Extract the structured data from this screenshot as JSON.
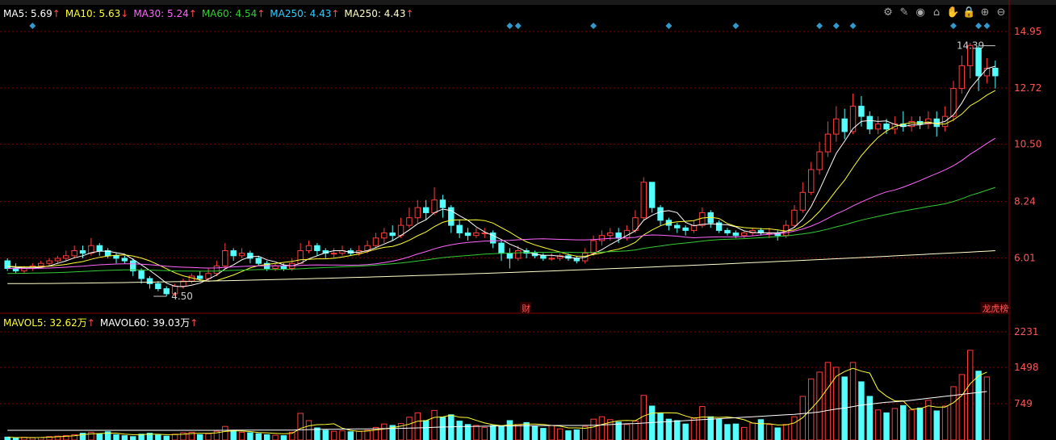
{
  "ma_legend": [
    {
      "label": "MA5: 5.69",
      "arrow": "↑",
      "color": "#ffffff"
    },
    {
      "label": "MA10: 5.63",
      "arrow": "↓",
      "color": "#ffff33"
    },
    {
      "label": "MA30: 5.24",
      "arrow": "↑",
      "color": "#ff66ff"
    },
    {
      "label": "MA60: 4.54",
      "arrow": "↑",
      "color": "#33cc33"
    },
    {
      "label": "MA250: 4.43",
      "arrow": "↑",
      "color": "#33ccff"
    },
    {
      "label": "MA250: 4.43",
      "arrow": "↑",
      "color": "#ffffcc"
    }
  ],
  "vol_legend": [
    {
      "label": "MAVOL5: 32.62万",
      "arrow": "↑",
      "color": "#ffff33"
    },
    {
      "label": "MAVOL60: 39.03万",
      "arrow": "↑",
      "color": "#ffffff"
    }
  ],
  "toolbar_icons": [
    "gear-icon",
    "pen-icon",
    "eye-icon",
    "basket-icon",
    "hand-icon",
    "lock-icon",
    "zoom-in-icon",
    "zoom-out-icon"
  ],
  "colors": {
    "up": "#ff3c3c",
    "down": "#54ffff",
    "grid": "#8b0000"
  },
  "chart_data": [
    {
      "type": "candlestick",
      "y_ticks": [
        "14.95",
        "12.72",
        "10.50",
        "8.24",
        "6.01"
      ],
      "ylim": [
        4.15,
        15.3
      ],
      "annotations": [
        {
          "text": "14.39",
          "index": 118,
          "value": 14.39
        },
        {
          "text": "4.50",
          "index": 19,
          "value": 4.5
        },
        {
          "text": "财",
          "index": 62
        },
        {
          "text": "龙虎榜",
          "index": 117
        }
      ],
      "markers_index": [
        3,
        60,
        61,
        70,
        79,
        87,
        97,
        99,
        101,
        113,
        116,
        117
      ],
      "candles": [
        [
          5.9,
          5.6,
          6.0,
          5.5
        ],
        [
          5.6,
          5.5,
          5.8,
          5.4
        ],
        [
          5.5,
          5.6,
          5.7,
          5.4
        ],
        [
          5.6,
          5.7,
          5.8,
          5.5
        ],
        [
          5.7,
          5.8,
          5.9,
          5.6
        ],
        [
          5.8,
          5.9,
          6.0,
          5.7
        ],
        [
          5.9,
          6.0,
          6.1,
          5.8
        ],
        [
          6.0,
          6.1,
          6.3,
          5.9
        ],
        [
          6.1,
          6.3,
          6.5,
          6.0
        ],
        [
          6.3,
          6.2,
          6.5,
          6.0
        ],
        [
          6.2,
          6.5,
          6.8,
          6.1
        ],
        [
          6.5,
          6.3,
          6.6,
          6.1
        ],
        [
          6.3,
          6.1,
          6.4,
          6.0
        ],
        [
          6.1,
          6.0,
          6.2,
          5.8
        ],
        [
          6.0,
          5.9,
          6.1,
          5.8
        ],
        [
          5.9,
          5.5,
          6.0,
          5.3
        ],
        [
          5.5,
          5.2,
          5.6,
          5.0
        ],
        [
          5.2,
          5.0,
          5.3,
          4.8
        ],
        [
          5.0,
          4.8,
          5.1,
          4.7
        ],
        [
          4.8,
          4.6,
          4.9,
          4.5
        ],
        [
          4.6,
          4.9,
          5.0,
          4.5
        ],
        [
          4.9,
          5.1,
          5.2,
          4.8
        ],
        [
          5.1,
          5.3,
          5.4,
          5.0
        ],
        [
          5.3,
          5.2,
          5.5,
          5.1
        ],
        [
          5.2,
          5.4,
          5.6,
          5.1
        ],
        [
          5.4,
          5.7,
          5.9,
          5.3
        ],
        [
          5.7,
          6.3,
          6.6,
          5.6
        ],
        [
          6.3,
          6.1,
          6.4,
          5.9
        ],
        [
          6.1,
          6.2,
          6.4,
          6.0
        ],
        [
          6.2,
          6.0,
          6.3,
          5.8
        ],
        [
          6.0,
          5.8,
          6.1,
          5.7
        ],
        [
          5.8,
          5.6,
          5.9,
          5.5
        ],
        [
          5.6,
          5.7,
          5.8,
          5.5
        ],
        [
          5.7,
          5.6,
          5.8,
          5.5
        ],
        [
          5.6,
          5.8,
          6.0,
          5.5
        ],
        [
          5.8,
          6.3,
          6.6,
          5.8
        ],
        [
          6.3,
          6.5,
          6.7,
          6.2
        ],
        [
          6.5,
          6.3,
          6.6,
          6.1
        ],
        [
          6.3,
          6.2,
          6.4,
          6.0
        ],
        [
          6.2,
          6.2,
          6.4,
          6.0
        ],
        [
          6.2,
          6.3,
          6.5,
          6.1
        ],
        [
          6.3,
          6.2,
          6.4,
          6.1
        ],
        [
          6.2,
          6.3,
          6.5,
          6.1
        ],
        [
          6.3,
          6.5,
          6.7,
          6.2
        ],
        [
          6.5,
          6.8,
          7.0,
          6.4
        ],
        [
          6.8,
          7.0,
          7.2,
          6.6
        ],
        [
          7.0,
          6.9,
          7.3,
          6.7
        ],
        [
          6.9,
          7.3,
          7.6,
          6.8
        ],
        [
          7.3,
          7.6,
          8.0,
          7.2
        ],
        [
          7.6,
          8.0,
          8.3,
          7.4
        ],
        [
          8.0,
          7.8,
          8.3,
          7.5
        ],
        [
          7.8,
          8.3,
          8.8,
          7.7
        ],
        [
          8.3,
          8.0,
          8.5,
          7.6
        ],
        [
          8.0,
          7.3,
          8.1,
          7.0
        ],
        [
          7.3,
          7.0,
          7.5,
          6.8
        ],
        [
          7.0,
          6.9,
          7.2,
          6.7
        ],
        [
          6.9,
          7.0,
          7.2,
          6.8
        ],
        [
          7.0,
          7.0,
          7.2,
          6.8
        ],
        [
          7.0,
          6.6,
          7.1,
          6.4
        ],
        [
          6.6,
          6.2,
          6.7,
          5.9
        ],
        [
          6.2,
          6.0,
          6.4,
          5.6
        ],
        [
          6.0,
          6.3,
          6.5,
          5.9
        ],
        [
          6.3,
          6.2,
          6.4,
          6.0
        ],
        [
          6.2,
          6.1,
          6.3,
          6.0
        ],
        [
          6.1,
          6.0,
          6.2,
          5.9
        ],
        [
          6.0,
          6.0,
          6.2,
          5.9
        ],
        [
          6.0,
          6.1,
          6.2,
          5.9
        ],
        [
          6.1,
          6.0,
          6.2,
          5.9
        ],
        [
          6.0,
          5.9,
          6.1,
          5.8
        ],
        [
          5.9,
          6.2,
          6.4,
          5.8
        ],
        [
          6.2,
          6.7,
          6.9,
          6.1
        ],
        [
          6.7,
          6.9,
          7.1,
          6.5
        ],
        [
          6.9,
          7.0,
          7.2,
          6.7
        ],
        [
          7.0,
          6.8,
          7.2,
          6.6
        ],
        [
          6.8,
          7.1,
          7.3,
          6.7
        ],
        [
          7.1,
          7.6,
          7.9,
          7.0
        ],
        [
          7.6,
          9.0,
          9.2,
          7.5
        ],
        [
          9.0,
          8.0,
          9.0,
          7.8
        ],
        [
          8.0,
          7.5,
          8.1,
          7.3
        ],
        [
          7.5,
          7.3,
          7.6,
          7.1
        ],
        [
          7.3,
          7.2,
          7.4,
          7.0
        ],
        [
          7.2,
          7.1,
          7.3,
          6.9
        ],
        [
          7.1,
          7.3,
          7.5,
          7.0
        ],
        [
          7.3,
          7.8,
          8.0,
          7.2
        ],
        [
          7.8,
          7.4,
          7.9,
          7.2
        ],
        [
          7.4,
          7.1,
          7.5,
          7.0
        ],
        [
          7.1,
          7.0,
          7.2,
          6.9
        ],
        [
          7.0,
          6.9,
          7.1,
          6.8
        ],
        [
          6.9,
          7.0,
          7.1,
          6.8
        ],
        [
          7.0,
          7.1,
          7.2,
          6.9
        ],
        [
          7.1,
          7.0,
          7.2,
          6.9
        ],
        [
          7.0,
          7.0,
          7.2,
          6.8
        ],
        [
          7.0,
          6.9,
          7.1,
          6.7
        ],
        [
          6.9,
          7.3,
          7.5,
          6.8
        ],
        [
          7.3,
          7.9,
          8.1,
          7.2
        ],
        [
          7.9,
          8.6,
          9.0,
          7.8
        ],
        [
          8.6,
          9.5,
          9.8,
          8.5
        ],
        [
          9.5,
          10.2,
          10.6,
          9.3
        ],
        [
          10.2,
          10.9,
          11.4,
          10.0
        ],
        [
          10.9,
          11.5,
          12.0,
          10.6
        ],
        [
          11.5,
          11.0,
          11.9,
          10.7
        ],
        [
          11.0,
          12.0,
          12.5,
          10.9
        ],
        [
          12.0,
          11.6,
          12.4,
          11.2
        ],
        [
          11.6,
          11.1,
          11.8,
          10.9
        ],
        [
          11.1,
          11.3,
          11.6,
          10.9
        ],
        [
          11.3,
          11.1,
          11.5,
          10.9
        ],
        [
          11.1,
          11.3,
          11.6,
          10.9
        ],
        [
          11.3,
          11.2,
          11.8,
          11.0
        ],
        [
          11.2,
          11.4,
          11.6,
          11.0
        ],
        [
          11.4,
          11.3,
          11.6,
          11.1
        ],
        [
          11.3,
          11.5,
          11.8,
          11.1
        ],
        [
          11.5,
          11.2,
          11.8,
          10.8
        ],
        [
          11.2,
          11.6,
          12.0,
          11.0
        ],
        [
          11.6,
          12.7,
          13.0,
          11.4
        ],
        [
          12.7,
          13.6,
          14.0,
          12.5
        ],
        [
          13.6,
          14.4,
          14.5,
          13.1
        ],
        [
          14.3,
          13.2,
          14.4,
          12.6
        ],
        [
          13.2,
          13.5,
          13.9,
          12.9
        ],
        [
          13.5,
          13.2,
          13.8,
          12.7
        ]
      ],
      "ma_lines": [
        "MA5",
        "MA10",
        "MA30",
        "MA60",
        "MA250"
      ]
    },
    {
      "type": "bar",
      "y_ticks": [
        "2231",
        "1498",
        "749"
      ],
      "ylim": [
        0,
        2231
      ],
      "volumes": [
        60,
        40,
        55,
        45,
        50,
        70,
        80,
        90,
        110,
        140,
        160,
        130,
        170,
        110,
        90,
        70,
        120,
        140,
        100,
        80,
        120,
        150,
        160,
        110,
        130,
        180,
        280,
        200,
        160,
        150,
        130,
        110,
        100,
        90,
        160,
        550,
        400,
        250,
        200,
        180,
        190,
        170,
        180,
        200,
        260,
        330,
        300,
        340,
        470,
        560,
        400,
        610,
        470,
        520,
        390,
        320,
        300,
        260,
        300,
        280,
        400,
        320,
        360,
        280,
        240,
        300,
        230,
        190,
        210,
        280,
        430,
        480,
        420,
        370,
        320,
        390,
        920,
        700,
        560,
        430,
        400,
        330,
        460,
        690,
        480,
        430,
        320,
        330,
        260,
        350,
        420,
        320,
        250,
        320,
        480,
        900,
        1260,
        1400,
        1600,
        1500,
        1300,
        1600,
        1200,
        900,
        620,
        560,
        650,
        710,
        620,
        660,
        820,
        600,
        700,
        1100,
        1350,
        1850,
        1420,
        1300
      ],
      "mavol5_points": [
        60,
        50,
        52,
        50,
        52,
        58,
        66,
        76,
        88,
        110,
        126,
        134,
        142,
        142,
        120,
        110,
        110,
        120,
        118,
        110,
        112,
        118,
        134,
        140,
        138,
        148,
        176,
        190,
        184,
        174,
        154,
        148,
        138,
        128,
        136,
        238,
        292,
        316,
        320,
        334,
        244,
        198,
        178,
        184,
        208,
        226,
        254,
        286,
        328,
        388,
        400,
        466,
        476,
        512,
        470,
        462,
        404,
        352,
        316,
        294,
        312,
        316,
        330,
        328,
        320,
        300,
        286,
        250,
        250,
        242,
        268,
        318,
        364,
        398,
        404,
        398,
        494,
        554,
        560,
        562,
        556,
        496,
        448,
        474,
        472,
        466,
        474,
        456,
        418,
        350,
        334,
        334,
        310,
        312,
        352,
        462,
        642,
        836,
        1072,
        1314,
        1412,
        1480,
        1420,
        1380,
        1040,
        904,
        806,
        808,
        632,
        642,
        706,
        680,
        680,
        770,
        916,
        1160,
        1324,
        1400
      ],
      "mavol60_points": [
        200,
        200,
        200,
        200,
        200,
        200,
        200,
        200,
        200,
        200,
        200,
        200,
        200,
        200,
        200,
        200,
        200,
        200,
        200,
        200,
        200,
        200,
        200,
        200,
        200,
        200,
        200,
        205,
        205,
        205,
        205,
        205,
        205,
        205,
        205,
        210,
        215,
        218,
        220,
        222,
        224,
        226,
        228,
        230,
        232,
        234,
        236,
        240,
        245,
        250,
        255,
        262,
        268,
        272,
        276,
        280,
        282,
        284,
        286,
        288,
        290,
        292,
        294,
        296,
        298,
        300,
        300,
        300,
        300,
        302,
        305,
        310,
        318,
        326,
        334,
        340,
        350,
        360,
        370,
        380,
        390,
        400,
        410,
        420,
        430,
        440,
        450,
        460,
        470,
        480,
        490,
        500,
        510,
        520,
        530,
        545,
        560,
        580,
        610,
        640,
        660,
        690,
        720,
        740,
        760,
        780,
        790,
        800,
        820,
        840,
        860,
        880,
        900,
        920,
        940,
        960,
        980,
        1000
      ]
    }
  ]
}
